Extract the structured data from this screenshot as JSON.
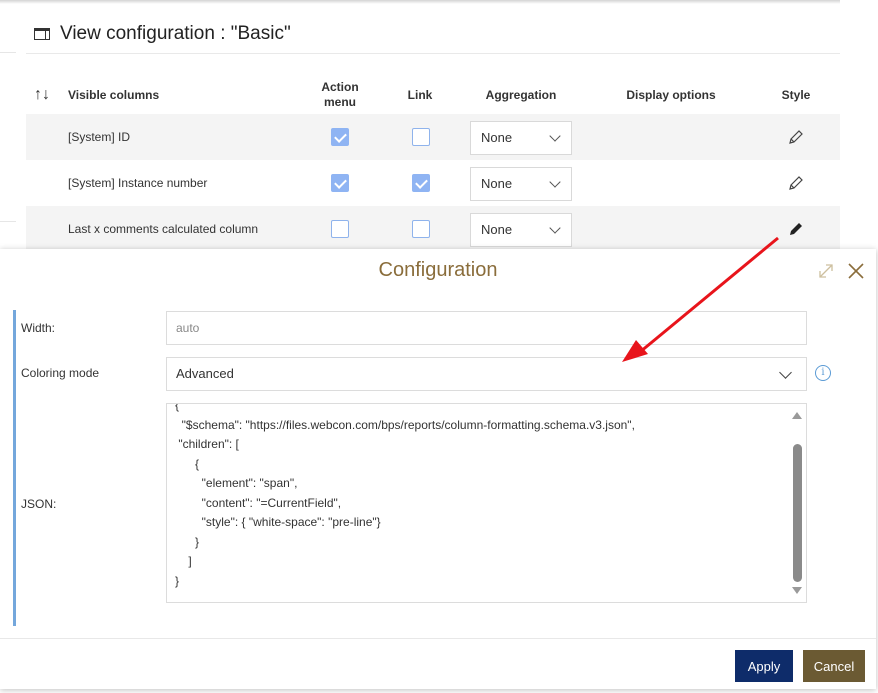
{
  "view": {
    "title": "View configuration : \"Basic\""
  },
  "grid": {
    "headers": {
      "visible_columns": "Visible columns",
      "action_menu": "Action menu",
      "link": "Link",
      "aggregation": "Aggregation",
      "display_options": "Display options",
      "style": "Style"
    },
    "rows": [
      {
        "label": "[System] ID",
        "action_menu": true,
        "link": false,
        "aggregation": "None",
        "style_active": false
      },
      {
        "label": "[System] Instance number",
        "action_menu": true,
        "link": true,
        "aggregation": "None",
        "style_active": false
      },
      {
        "label": "Last x comments calculated column",
        "action_menu": false,
        "link": false,
        "aggregation": "None",
        "style_active": true
      }
    ]
  },
  "dialog": {
    "title": "Configuration",
    "width_label": "Width:",
    "width_placeholder": "auto",
    "coloring_label": "Coloring mode",
    "coloring_value": "Advanced",
    "json_label": "JSON:",
    "json_lines": [
      "{",
      "  \"$schema\": \"https://files.webcon.com/bps/reports/column-formatting.schema.v3.json\",",
      " \"children\": [",
      "      {",
      "        \"element\": \"span\",",
      "        \"content\": \"=CurrentField\",",
      "        \"style\": { \"white-space\": \"pre-line\"}",
      "      }",
      "    ]",
      "}"
    ],
    "apply_label": "Apply",
    "cancel_label": "Cancel"
  },
  "colors": {
    "accent_title": "#8a6d3b",
    "apply_bg": "#0e2c6a",
    "cancel_bg": "#6b5a33",
    "checkbox": "#8fb4f3",
    "annotation_arrow": "#e8141b"
  }
}
